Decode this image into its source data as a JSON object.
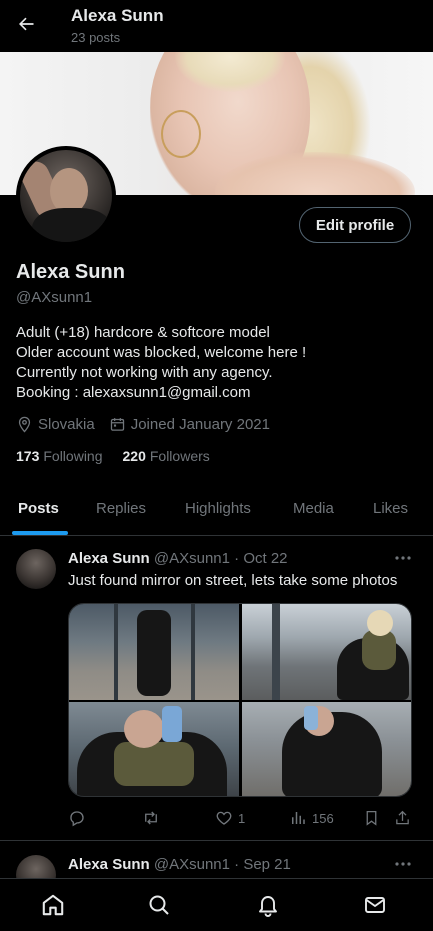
{
  "header": {
    "name": "Alexa Sunn",
    "posts_count": "23 posts"
  },
  "profile": {
    "name": "Alexa Sunn",
    "handle": "@AXsunn1",
    "edit_label": "Edit profile",
    "bio": [
      "Adult (+18) hardcore & softcore model",
      "Older account was blocked, welcome here !",
      "Currently not working with any agency.",
      "Booking : alexaxsunn1@gmail.com"
    ],
    "location": "Slovakia",
    "joined": "Joined January 2021",
    "following_count": "173",
    "following_label": "Following",
    "followers_count": "220",
    "followers_label": "Followers"
  },
  "tabs": [
    "Posts",
    "Replies",
    "Highlights",
    "Media",
    "Likes"
  ],
  "tweets": [
    {
      "name": "Alexa Sunn",
      "handle": "@AXsunn1",
      "sep": "·",
      "date": "Oct 22",
      "text": "Just found mirror on street, lets take some photos",
      "likes": "1",
      "views": "156"
    },
    {
      "name": "Alexa Sunn",
      "handle": "@AXsunn1",
      "sep": "·",
      "date": "Sep 21"
    }
  ],
  "icons": {
    "back": "arrow-left-icon",
    "more": "more-dots-icon",
    "location": "location-pin-icon",
    "calendar": "calendar-icon",
    "reply": "reply-icon",
    "retweet": "retweet-icon",
    "like": "heart-icon",
    "views": "views-icon",
    "bookmark": "bookmark-icon",
    "share": "share-icon",
    "home": "home-icon",
    "search": "search-icon",
    "notifications": "bell-icon",
    "messages": "mail-icon"
  },
  "colors": {
    "accent": "#1d9bf0",
    "background": "#000000",
    "text": "#e7e9ea",
    "muted": "#71767b",
    "border": "#2f3336"
  }
}
